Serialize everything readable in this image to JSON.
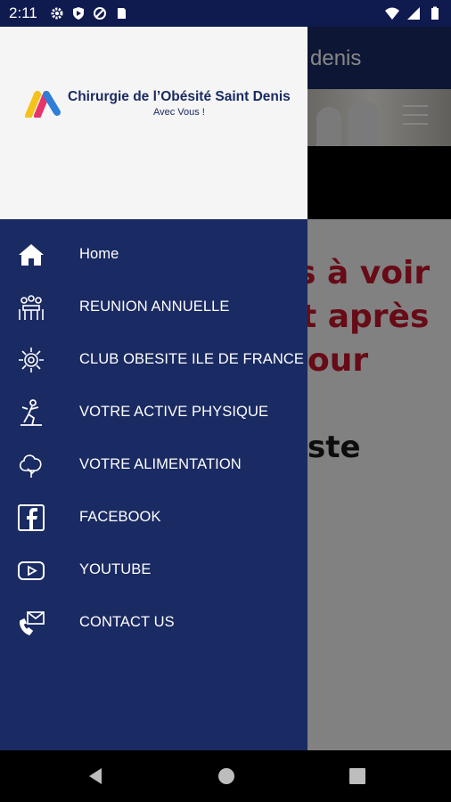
{
  "status_bar": {
    "time": "2:11"
  },
  "background_app": {
    "header_title": "denis",
    "text_lines": [
      "s à voir",
      "t après",
      "our",
      "ste"
    ]
  },
  "drawer": {
    "logo": {
      "title": "Chirurgie de l’Obésité Saint Denis",
      "subtitle": "Avec Vous !"
    },
    "items": [
      {
        "label": "Home",
        "icon": "home-icon"
      },
      {
        "label": "REUNION ANNUELLE",
        "icon": "meeting-icon"
      },
      {
        "label": "CLUB OBESITE ILE DE FRANCE",
        "icon": "club-icon"
      },
      {
        "label": "VOTRE ACTIVE PHYSIQUE",
        "icon": "fitness-icon"
      },
      {
        "label": "VOTRE ALIMENTATION",
        "icon": "food-icon"
      },
      {
        "label": "FACEBOOK",
        "icon": "facebook-icon"
      },
      {
        "label": "YOUTUBE",
        "icon": "youtube-icon"
      },
      {
        "label": "CONTACT US",
        "icon": "contact-icon"
      }
    ]
  },
  "colors": {
    "drawer_bg": "#1a2a62",
    "accent_red": "#c3162a",
    "status_bar": "#0f1a4f"
  }
}
